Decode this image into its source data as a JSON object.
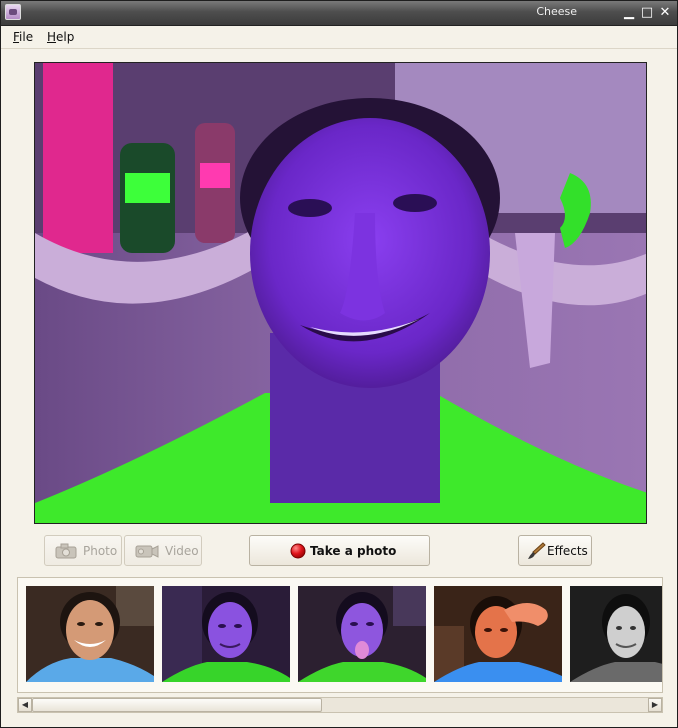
{
  "window": {
    "title": "Cheese",
    "minimize_glyph": "▁",
    "maximize_glyph": "□",
    "close_glyph": "✕"
  },
  "menubar": {
    "items": [
      {
        "mnemonic": "F",
        "rest": "ile"
      },
      {
        "mnemonic": "H",
        "rest": "elp"
      }
    ]
  },
  "controls": {
    "photo_mode_label": "Photo",
    "video_mode_label": "Video",
    "take_photo_label": "Take a photo",
    "effects_label": "Effects"
  },
  "icons": {
    "app": "cheese-app-icon",
    "photo_mode": "camera-icon",
    "video_mode": "video-camera-icon",
    "take_photo": "record-icon",
    "effects": "paintbrush-icon"
  },
  "colors": {
    "record_red": "#e0141b",
    "webcam_tint": "#7b3fb0",
    "shirt_green": "#39e82a"
  },
  "thumbnails": [
    {
      "tone": "normal",
      "shirt": "#5aa9e8"
    },
    {
      "tone": "purple",
      "shirt": "#37d42a"
    },
    {
      "tone": "purple",
      "shirt": "#3fd62c"
    },
    {
      "tone": "warm",
      "shirt": "#3a8ff0"
    },
    {
      "tone": "gray",
      "shirt": "#6a6a6a"
    }
  ]
}
